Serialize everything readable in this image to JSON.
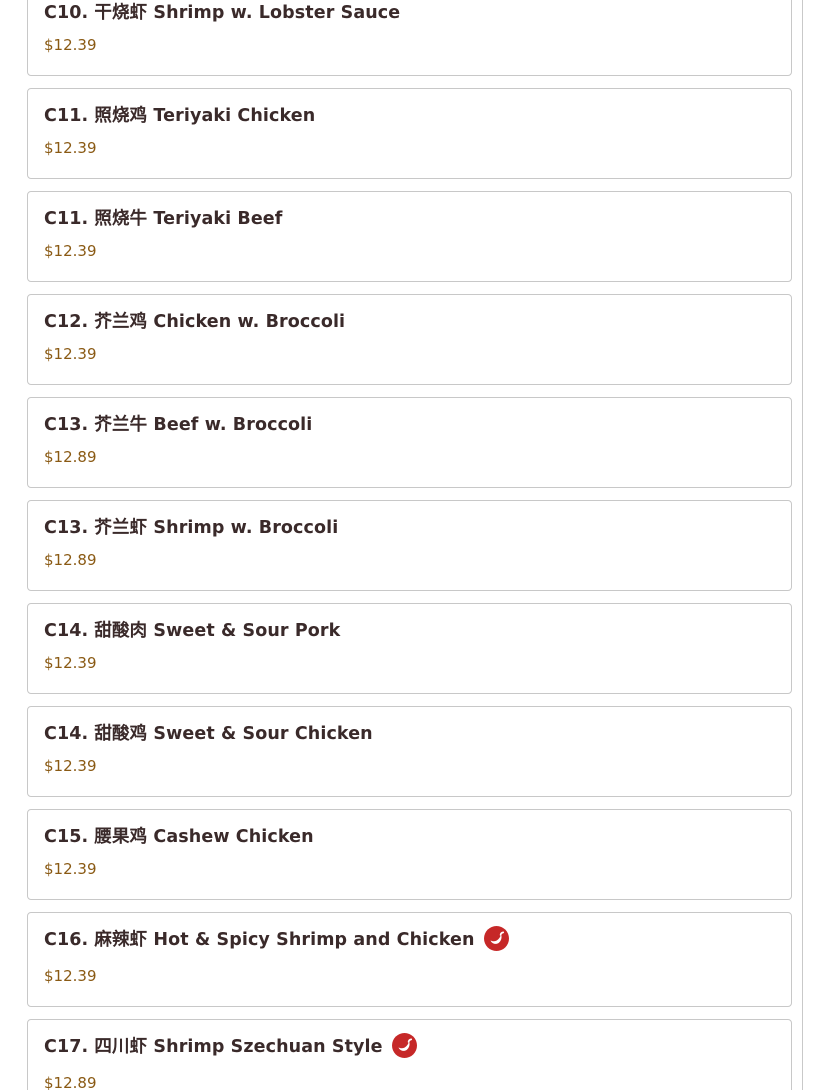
{
  "menu": {
    "items": [
      {
        "name": "C10. 干烧虾 Shrimp w. Lobster Sauce",
        "price": "$12.39",
        "spicy": false
      },
      {
        "name": "C11. 照烧鸡 Teriyaki Chicken",
        "price": "$12.39",
        "spicy": false
      },
      {
        "name": "C11. 照烧牛 Teriyaki Beef",
        "price": "$12.39",
        "spicy": false
      },
      {
        "name": "C12. 芥兰鸡 Chicken w. Broccoli",
        "price": "$12.39",
        "spicy": false
      },
      {
        "name": "C13. 芥兰牛 Beef w. Broccoli",
        "price": "$12.89",
        "spicy": false
      },
      {
        "name": "C13. 芥兰虾 Shrimp w. Broccoli",
        "price": "$12.89",
        "spicy": false
      },
      {
        "name": "C14. 甜酸肉 Sweet & Sour Pork",
        "price": "$12.39",
        "spicy": false
      },
      {
        "name": "C14. 甜酸鸡 Sweet & Sour Chicken",
        "price": "$12.39",
        "spicy": false
      },
      {
        "name": "C15. 腰果鸡 Cashew Chicken",
        "price": "$12.39",
        "spicy": false
      },
      {
        "name": "C16. 麻辣虾 Hot & Spicy Shrimp and Chicken",
        "price": "$12.39",
        "spicy": true
      },
      {
        "name": "C17. 四川虾 Shrimp Szechuan Style",
        "price": "$12.89",
        "spicy": true
      }
    ],
    "spicy_icon": "chili-pepper-icon",
    "colors": {
      "title": "#3a2a2a",
      "price": "#8a5a14",
      "spicy_badge": "#c62828",
      "border": "#c8c8c8"
    }
  }
}
